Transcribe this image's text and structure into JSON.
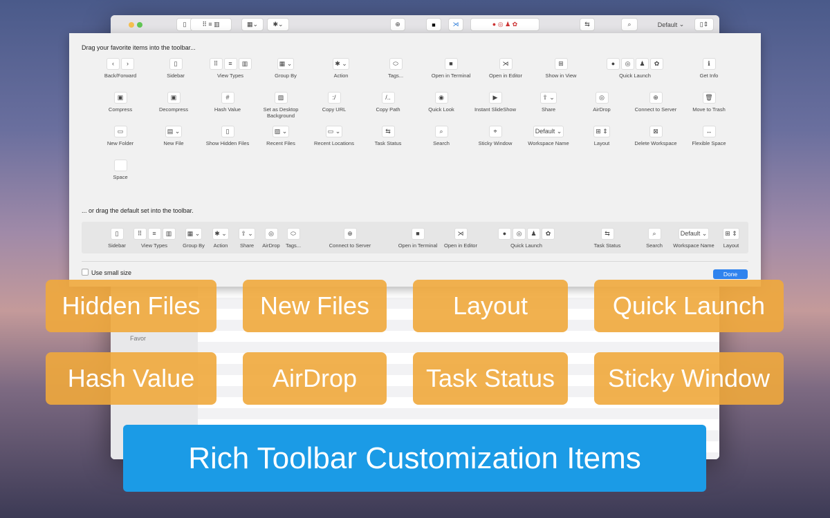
{
  "colors": {
    "tag": "#f0a83c",
    "banner": "#1b9be6",
    "done": "#2f83ee"
  },
  "toolbar": {
    "workspace": "Default"
  },
  "sidebar": {
    "favorites": "Favor"
  },
  "sheet": {
    "palette_hint": "Drag your favorite items into the toolbar...",
    "default_hint": "... or drag the default set into the toolbar.",
    "small_size": "Use small size",
    "done": "Done",
    "palette": [
      {
        "label": "Back/Forward",
        "icons": [
          "‹",
          "›"
        ]
      },
      {
        "label": "Sidebar",
        "icons": [
          "▯"
        ]
      },
      {
        "label": "View Types",
        "icons": [
          "⠿",
          "≡",
          "▥"
        ]
      },
      {
        "label": "Group By",
        "icons": [
          "▦ ⌄"
        ]
      },
      {
        "label": "Action",
        "icons": [
          "✱ ⌄"
        ]
      },
      {
        "label": "Tags...",
        "icons": [
          "⬭"
        ]
      },
      {
        "label": "Open in Terminal",
        "icons": [
          "■"
        ]
      },
      {
        "label": "Open in Editor",
        "icons": [
          "⋊"
        ]
      },
      {
        "label": "Show in View",
        "icons": [
          "⊞"
        ]
      },
      {
        "label": "Quick Launch",
        "icons": [
          "●",
          "◎",
          "♟",
          "✿"
        ]
      },
      {
        "label": "Get Info",
        "icons": [
          "ℹ"
        ]
      },
      {
        "label": "Compress",
        "icons": [
          "▣"
        ]
      },
      {
        "label": "Decompress",
        "icons": [
          "▣"
        ]
      },
      {
        "label": "Hash Value",
        "icons": [
          "#"
        ]
      },
      {
        "label": "Set as Desktop Background",
        "icons": [
          "▨"
        ]
      },
      {
        "label": "Copy URL",
        "icons": [
          ":/"
        ]
      },
      {
        "label": "Copy Path",
        "icons": [
          "/.."
        ]
      },
      {
        "label": "Quick Look",
        "icons": [
          "◉"
        ]
      },
      {
        "label": "Instant SlideShow",
        "icons": [
          "▶"
        ]
      },
      {
        "label": "Share",
        "icons": [
          "⇧ ⌄"
        ]
      },
      {
        "label": "AirDrop",
        "icons": [
          "◎"
        ]
      },
      {
        "label": "Connect to Server",
        "icons": [
          "⊕"
        ]
      },
      {
        "label": "Move to Trash",
        "icons": [
          "🗑"
        ]
      },
      {
        "label": "New Folder",
        "icons": [
          "▭"
        ]
      },
      {
        "label": "New File",
        "icons": [
          "▤ ⌄"
        ]
      },
      {
        "label": "Show Hidden Files",
        "icons": [
          "▯"
        ]
      },
      {
        "label": "Recent Files",
        "icons": [
          "▨ ⌄"
        ]
      },
      {
        "label": "Recent Locations",
        "icons": [
          "▭ ⌄"
        ]
      },
      {
        "label": "Task Status",
        "icons": [
          "⇆"
        ]
      },
      {
        "label": "Search",
        "icons": [
          "⌕"
        ]
      },
      {
        "label": "Sticky Window",
        "icons": [
          "⌖"
        ]
      },
      {
        "label": "Workspace Name",
        "icons": [
          "Default ⌄"
        ]
      },
      {
        "label": "Layout",
        "icons": [
          "⊞ ⇕"
        ]
      },
      {
        "label": "Delete Workspace",
        "icons": [
          "⊠"
        ]
      },
      {
        "label": "Flexible Space",
        "icons": [
          "↔"
        ]
      },
      {
        "label": "Space",
        "icons": [
          " "
        ]
      }
    ],
    "defaults": [
      {
        "label": "Sidebar",
        "icons": [
          "▯"
        ]
      },
      {
        "label": "View Types",
        "icons": [
          "⠿",
          "≡",
          "▥"
        ]
      },
      {
        "label": "Group By",
        "icons": [
          "▦ ⌄"
        ]
      },
      {
        "label": "Action",
        "icons": [
          "✱ ⌄"
        ]
      },
      {
        "label": "Share",
        "icons": [
          "⇧ ⌄"
        ]
      },
      {
        "label": "AirDrop",
        "icons": [
          "◎"
        ]
      },
      {
        "label": "Tags...",
        "icons": [
          "⬭"
        ]
      },
      {
        "label": "Connect to Server",
        "icons": [
          "⊕"
        ]
      },
      {
        "label": "Open in Terminal",
        "icons": [
          "■"
        ]
      },
      {
        "label": "Open in Editor",
        "icons": [
          "⋊"
        ]
      },
      {
        "label": "Quick Launch",
        "icons": [
          "●",
          "◎",
          "♟",
          "✿"
        ]
      },
      {
        "label": "Task Status",
        "icons": [
          "⇆"
        ]
      },
      {
        "label": "Search",
        "icons": [
          "⌕"
        ]
      },
      {
        "label": "Workspace Name",
        "icons": [
          "Default ⌄"
        ]
      },
      {
        "label": "Layout",
        "icons": [
          "⊞ ⇕"
        ]
      }
    ]
  },
  "tags": [
    "Hidden Files",
    "New Files",
    "Layout",
    "Quick Launch",
    "Hash Value",
    "AirDrop",
    "Task Status",
    "Sticky Window"
  ],
  "banner": "Rich Toolbar Customization Items"
}
